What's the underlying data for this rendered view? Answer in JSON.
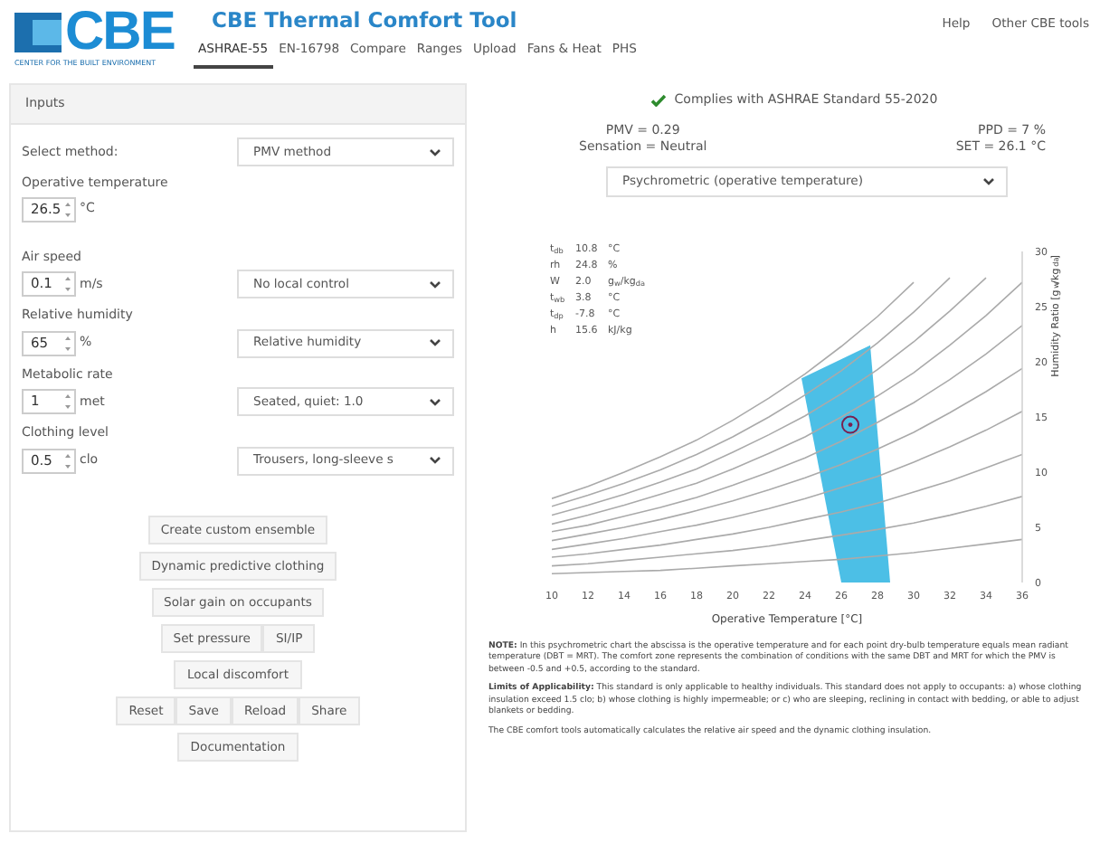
{
  "header": {
    "logo_text": "CBE",
    "logo_subtitle": "CENTER FOR THE BUILT ENVIRONMENT",
    "title": "CBE Thermal Comfort Tool",
    "tabs": [
      {
        "label": "ASHRAE-55",
        "selected": true
      },
      {
        "label": "EN-16798",
        "selected": false
      },
      {
        "label": "Compare",
        "selected": false
      },
      {
        "label": "Ranges",
        "selected": false
      },
      {
        "label": "Upload",
        "selected": false
      },
      {
        "label": "Fans & Heat",
        "selected": false
      },
      {
        "label": "PHS",
        "selected": false
      }
    ],
    "links": [
      "Help",
      "Other CBE tools"
    ]
  },
  "inputs_panel": {
    "title": "Inputs",
    "method_label": "Select method:",
    "method_value": "PMV method",
    "fields": [
      {
        "label": "Operative temperature",
        "value": "26.5",
        "unit": "°C"
      },
      {
        "label": "Air speed",
        "value": "0.1",
        "unit": "m/s",
        "select": "No local control"
      },
      {
        "label": "Relative humidity",
        "value": "65",
        "unit": "%",
        "select": "Relative humidity"
      },
      {
        "label": "Metabolic rate",
        "value": "1",
        "unit": "met",
        "select": "Seated, quiet: 1.0"
      },
      {
        "label": "Clothing level",
        "value": "0.5",
        "unit": "clo",
        "select": "Trousers, long-sleeve s"
      }
    ],
    "button_rows": [
      {
        "buttons": [
          "Create custom ensemble"
        ]
      },
      {
        "buttons": [
          "Dynamic predictive clothing"
        ]
      },
      {
        "buttons": [
          "Solar gain on occupants"
        ]
      },
      {
        "buttons": [
          "Set pressure",
          "SI/IP"
        ]
      },
      {
        "buttons": [
          "Local discomfort"
        ]
      },
      {
        "buttons": [
          "Reset",
          "Save",
          "Reload",
          "Share"
        ]
      },
      {
        "buttons": [
          "Documentation"
        ]
      }
    ]
  },
  "results": {
    "compliance": "Complies with ASHRAE Standard 55-2020",
    "complies": true,
    "pmv": "PMV = 0.29",
    "ppd": "PPD = 7 %",
    "sensation": "Sensation = Neutral",
    "set": "SET = 26.1 °C",
    "chart_select": "Psychrometric (operative temperature)"
  },
  "chart": {
    "info": [
      {
        "label": "t$_{db}$",
        "value": "10.8",
        "unit": "°C"
      },
      {
        "label": "rh",
        "value": "24.8",
        "unit": "%"
      },
      {
        "label": "W",
        "value": "2.0",
        "unit": "g$_{w}$/kg$_{da}$"
      },
      {
        "label": "t$_{wb}$",
        "value": "3.8",
        "unit": "°C"
      },
      {
        "label": "t$_{dp}$",
        "value": "-7.8",
        "unit": "°C"
      },
      {
        "label": "h",
        "value": "15.6",
        "unit": "kJ/kg"
      }
    ],
    "chart_data": {
      "type": "line",
      "xlabel": "Operative Temperature [°C]",
      "ylabel": "Humidity Ratio [g$_{w}$/kg$_{da}$]",
      "xlim": [
        10,
        36
      ],
      "ylim": [
        0,
        30
      ],
      "xticks": [
        10,
        12,
        14,
        16,
        18,
        20,
        22,
        24,
        26,
        28,
        30,
        32,
        34,
        36
      ],
      "yticks": [
        0,
        5,
        10,
        15,
        20,
        25,
        30
      ],
      "x": [
        10,
        12,
        14,
        16,
        18,
        20,
        22,
        24,
        26,
        28,
        30,
        32,
        34,
        36
      ],
      "series": [
        {
          "values": [
            7.6,
            8.7,
            10.0,
            11.4,
            12.9,
            14.7,
            16.7,
            18.9,
            21.4,
            24.1,
            27.2,
            null,
            null,
            null
          ]
        },
        {
          "values": [
            6.9,
            7.9,
            9.0,
            10.2,
            11.6,
            13.2,
            15.0,
            17.0,
            19.2,
            21.7,
            24.5,
            27.6,
            null,
            null
          ]
        },
        {
          "values": [
            6.1,
            7.0,
            8.0,
            9.1,
            10.3,
            11.8,
            13.4,
            15.1,
            17.1,
            19.3,
            21.8,
            24.6,
            27.6,
            null
          ]
        },
        {
          "values": [
            5.3,
            6.1,
            7.0,
            8.0,
            9.0,
            10.3,
            11.7,
            13.2,
            15.0,
            16.9,
            19.0,
            21.5,
            24.2,
            27.2
          ]
        },
        {
          "values": [
            4.6,
            5.2,
            6.0,
            6.8,
            7.7,
            8.8,
            10.0,
            11.3,
            12.8,
            14.5,
            16.3,
            18.4,
            20.7,
            23.3
          ]
        },
        {
          "values": [
            3.8,
            4.4,
            5.0,
            5.7,
            6.5,
            7.4,
            8.4,
            9.5,
            10.7,
            12.1,
            13.6,
            15.4,
            17.3,
            19.4
          ]
        },
        {
          "values": [
            3.0,
            3.5,
            4.0,
            4.6,
            5.2,
            5.9,
            6.7,
            7.6,
            8.6,
            9.6,
            10.9,
            12.3,
            13.8,
            15.5
          ]
        },
        {
          "values": [
            2.3,
            2.6,
            3.0,
            3.4,
            3.9,
            4.4,
            5.0,
            5.7,
            6.4,
            7.2,
            8.2,
            9.2,
            10.4,
            11.6
          ]
        },
        {
          "values": [
            1.5,
            1.7,
            2.0,
            2.3,
            2.6,
            2.9,
            3.3,
            3.8,
            4.3,
            4.8,
            5.4,
            6.1,
            6.9,
            7.8
          ]
        },
        {
          "values": [
            0.8,
            0.9,
            1.0,
            1.1,
            1.3,
            1.5,
            1.7,
            1.9,
            2.1,
            2.4,
            2.7,
            3.1,
            3.5,
            3.9
          ]
        }
      ]
    }
  },
  "notes": [
    "**NOTE:** In this psychrometric chart the abscissa is the operative temperature and for each point dry-bulb temperature equals mean radiant temperature (DBT = MRT). The comfort zone represents the combination of conditions with the same DBT and MRT for which the PMV is between -0.5 and +0.5, according to the standard.",
    "**Limits of Applicability:** This standard is only applicable to healthy individuals. This standard does not apply to occupants: a) whose clothing insulation exceed 1.5 clo; b) whose clothing is highly impermeable; or c) who are sleeping, reclining in contact with bedding, or able to adjust blankets or bedding.",
    "The CBE comfort tools automatically calculates the relative air speed and the dynamic clothing insulation."
  ]
}
